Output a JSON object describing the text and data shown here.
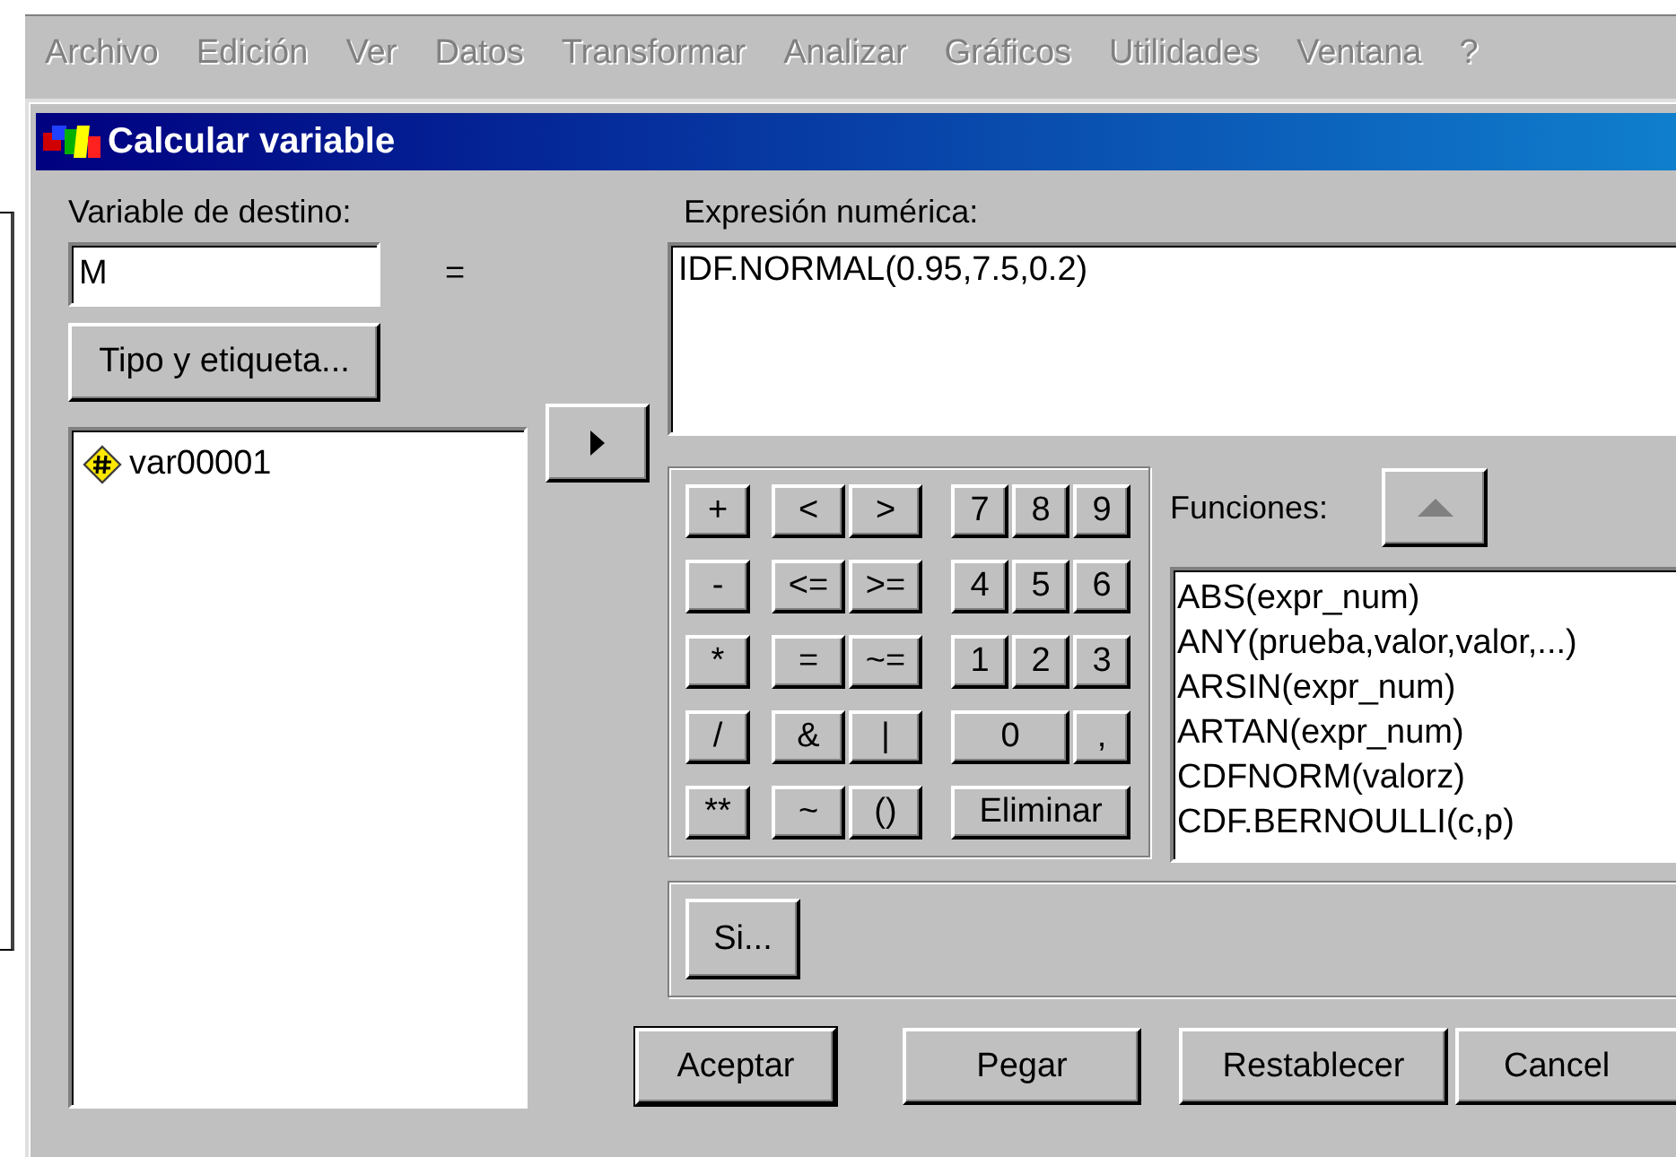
{
  "menu_bar": [
    {
      "label": "Archivo",
      "disabled": true
    },
    {
      "label": "Edición",
      "disabled": true
    },
    {
      "label": "Ver",
      "disabled": true
    },
    {
      "label": "Datos",
      "disabled": true
    },
    {
      "label": "Transformar",
      "disabled": true
    },
    {
      "label": "Analizar",
      "disabled": true
    },
    {
      "label": "Gráficos",
      "disabled": true
    },
    {
      "label": "Utilidades",
      "disabled": true
    },
    {
      "label": "Ventana",
      "disabled": true
    },
    {
      "label": "?",
      "disabled": true
    }
  ],
  "dialog": {
    "title": "Calcular variable",
    "target_variable": {
      "label": "Variable de destino:",
      "value": "M",
      "equals": "="
    },
    "type_label_button": "Tipo y etiqueta...",
    "variables": [
      {
        "name": "var00001",
        "selected": false
      }
    ],
    "expression": {
      "label": "Expresión numérica:",
      "value": "IDF.NORMAL(0.95,7.5,0.2)"
    },
    "keypad": [
      [
        {
          "label": "+",
          "kind": "key"
        },
        {
          "label": "<",
          "kind": "key"
        },
        {
          "label": ">",
          "kind": "key"
        },
        {
          "label": "7",
          "kind": "key"
        },
        {
          "label": "8",
          "kind": "key"
        },
        {
          "label": "9",
          "kind": "key"
        }
      ],
      [
        {
          "label": "-",
          "kind": "key"
        },
        {
          "label": "<=",
          "kind": "key"
        },
        {
          "label": ">=",
          "kind": "key"
        },
        {
          "label": "4",
          "kind": "key"
        },
        {
          "label": "5",
          "kind": "key"
        },
        {
          "label": "6",
          "kind": "key"
        }
      ],
      [
        {
          "label": "*",
          "kind": "key"
        },
        {
          "label": "=",
          "kind": "key"
        },
        {
          "label": "~=",
          "kind": "key"
        },
        {
          "label": "1",
          "kind": "key"
        },
        {
          "label": "2",
          "kind": "key"
        },
        {
          "label": "3",
          "kind": "key"
        }
      ],
      [
        {
          "label": "/",
          "kind": "key"
        },
        {
          "label": "&",
          "kind": "key"
        },
        {
          "label": "|",
          "kind": "key"
        },
        {
          "label": "0",
          "kind": "double"
        },
        {
          "label": ",",
          "kind": "key"
        }
      ],
      [
        {
          "label": "**",
          "kind": "key"
        },
        {
          "label": "~",
          "kind": "key"
        },
        {
          "label": "()",
          "kind": "key"
        },
        {
          "label": "Eliminar",
          "kind": "triple"
        }
      ]
    ],
    "functions": {
      "label": "Funciones:",
      "up_button_disabled": true,
      "items": [
        {
          "name": "ABS(expr_num)",
          "selected": false
        },
        {
          "name": "ANY(prueba,valor,valor,...)",
          "selected": false
        },
        {
          "name": "ARSIN(expr_num)",
          "selected": false
        },
        {
          "name": "ARTAN(expr_num)",
          "selected": false
        },
        {
          "name": "CDFNORM(valorz)",
          "selected": false
        },
        {
          "name": "CDF.BERNOULLI(c,p)",
          "selected": false
        }
      ]
    },
    "if_button": "Si...",
    "buttons": [
      {
        "label": "Aceptar",
        "default": true
      },
      {
        "label": "Pegar",
        "default": false
      },
      {
        "label": "Restablecer",
        "default": false
      },
      {
        "label": "Cancel",
        "default": false
      }
    ]
  }
}
